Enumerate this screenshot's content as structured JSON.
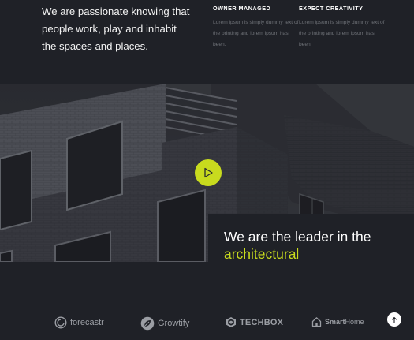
{
  "intro": {
    "tagline": "We are passionate knowing that people work, play and inhabit the spaces and places."
  },
  "features": [
    {
      "title": "OWNER MANAGED",
      "text": "Lorem ipsum is simply dummy text of the printing and lorem ipsum has been."
    },
    {
      "title": "EXPECT CREATIVITY",
      "text": "Lorem ipsum is simply dummy text of the printing and lorem ipsum has been."
    }
  ],
  "video": {
    "icon": "play-icon"
  },
  "leader": {
    "line1": "We are the leader in the",
    "highlight": "architectural"
  },
  "clients": [
    {
      "name": "forecastr",
      "icon": "forecastr-logo-icon"
    },
    {
      "name": "Growtify",
      "icon": "leaf-icon"
    },
    {
      "name": "TECHBOX",
      "icon": "hexagon-box-icon"
    },
    {
      "name_bold": "Smart",
      "name_light": "Home",
      "icon": "house-icon"
    }
  ],
  "scroll_top": {
    "icon": "arrow-up-icon"
  },
  "colors": {
    "accent": "#c8db1e",
    "background": "#1f2127",
    "muted_text": "#6f7278"
  }
}
